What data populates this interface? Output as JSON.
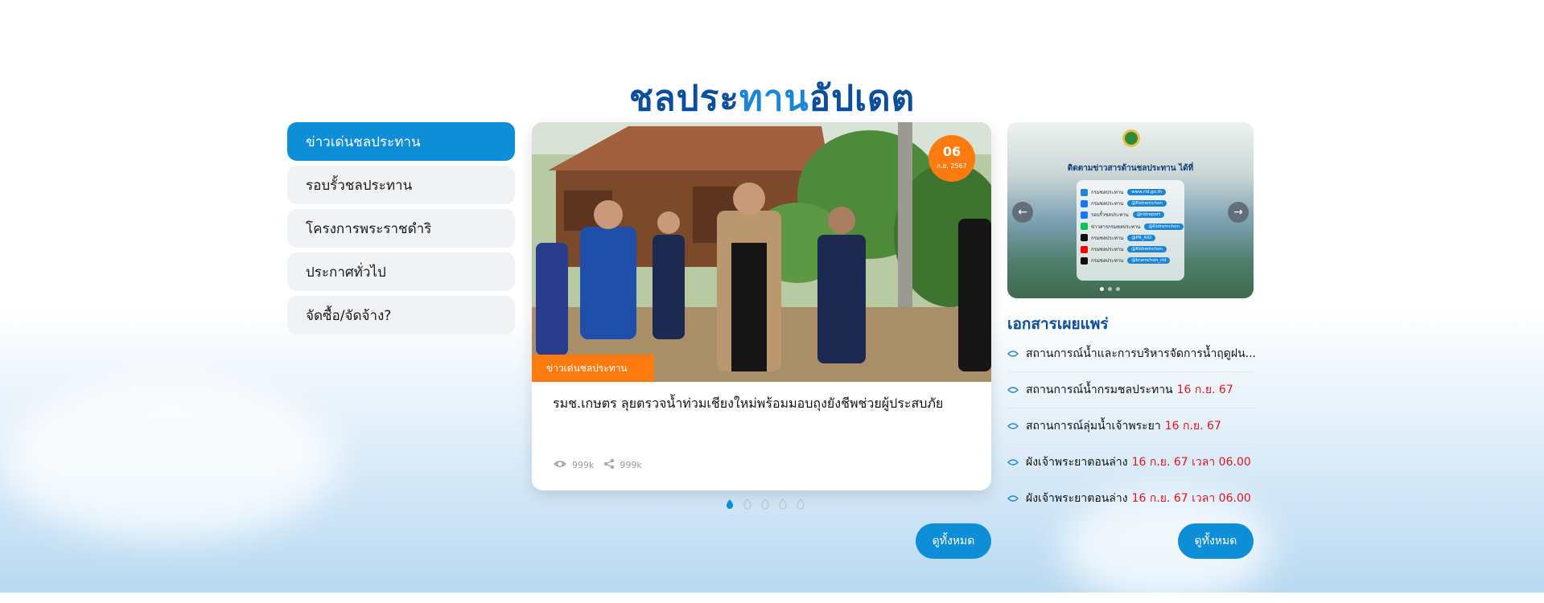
{
  "section_title": {
    "part1": "ชลประ",
    "part2": "ทาน",
    "part3": "อัปเดต"
  },
  "menu": [
    {
      "label": "ข่าวเด่นชลประทาน",
      "active": true
    },
    {
      "label": "รอบรั้วชลประทาน",
      "active": false
    },
    {
      "label": "โครงการพระราชดำริ",
      "active": false
    },
    {
      "label": "ประกาศทั่วไป",
      "active": false
    },
    {
      "label": "จัดซื้อ/จัดจ้าง?",
      "active": false
    }
  ],
  "news": {
    "date_day": "06",
    "date_month": "ก.ย. 2567",
    "category": "ข่าวเด่นชลประทาน",
    "headline": "รมช.เกษตร ลุยตรวจน้ำท่วมเชียงใหม่พร้อมมอบถุงยังชีพช่วยผู้ประสบภัย",
    "views": "999k",
    "shares": "999k",
    "view_all": "ดูทั้งหมด"
  },
  "banner": {
    "title": "ติดตามข่าวสารด้านชลประทาน ได้ที่",
    "rows": [
      {
        "name": "กรมชลประทาน",
        "handle": "www.rid.go.th",
        "color": "#1b86d6"
      },
      {
        "name": "กรมชลประทาน",
        "handle": "@Ridremchon",
        "color": "#1877f2"
      },
      {
        "name": "รอบรั้วชลประทาน",
        "handle": "@ridreport",
        "color": "#1877f2"
      },
      {
        "name": "ข่าวสารกรมชลประทาน",
        "handle": "@Ridremchon",
        "color": "#06c755"
      },
      {
        "name": "กรมชลประทาน",
        "handle": "@PR_RID",
        "color": "#111111"
      },
      {
        "name": "กรมชลประทาน",
        "handle": "@Ridremchon",
        "color": "#ff0000"
      },
      {
        "name": "กรมชลประทาน",
        "handle": "@kramchon_rid",
        "color": "#111111"
      }
    ]
  },
  "documents": {
    "title": "เอกสารเผยแพร่",
    "items": [
      {
        "text": "สถานการณ์น้ำและการบริหารจัดการน้ำฤดูฝน...",
        "highlight": ""
      },
      {
        "text": "สถานการณ์น้ำกรมชลประทาน",
        "highlight": "16 ก.ย. 67"
      },
      {
        "text": "สถานการณ์ลุ่มน้ำเจ้าพระยา",
        "highlight": "16 ก.ย. 67"
      },
      {
        "text": "ผังเจ้าพระยาตอนล่าง",
        "highlight": "16 ก.ย. 67 เวลา 06.00 น ."
      },
      {
        "text": "ผังเจ้าพระยาตอนล่าง",
        "highlight": "16 ก.ย. 67 เวลา 06.00 น ."
      }
    ],
    "view_all": "ดูทั้งหมด"
  }
}
